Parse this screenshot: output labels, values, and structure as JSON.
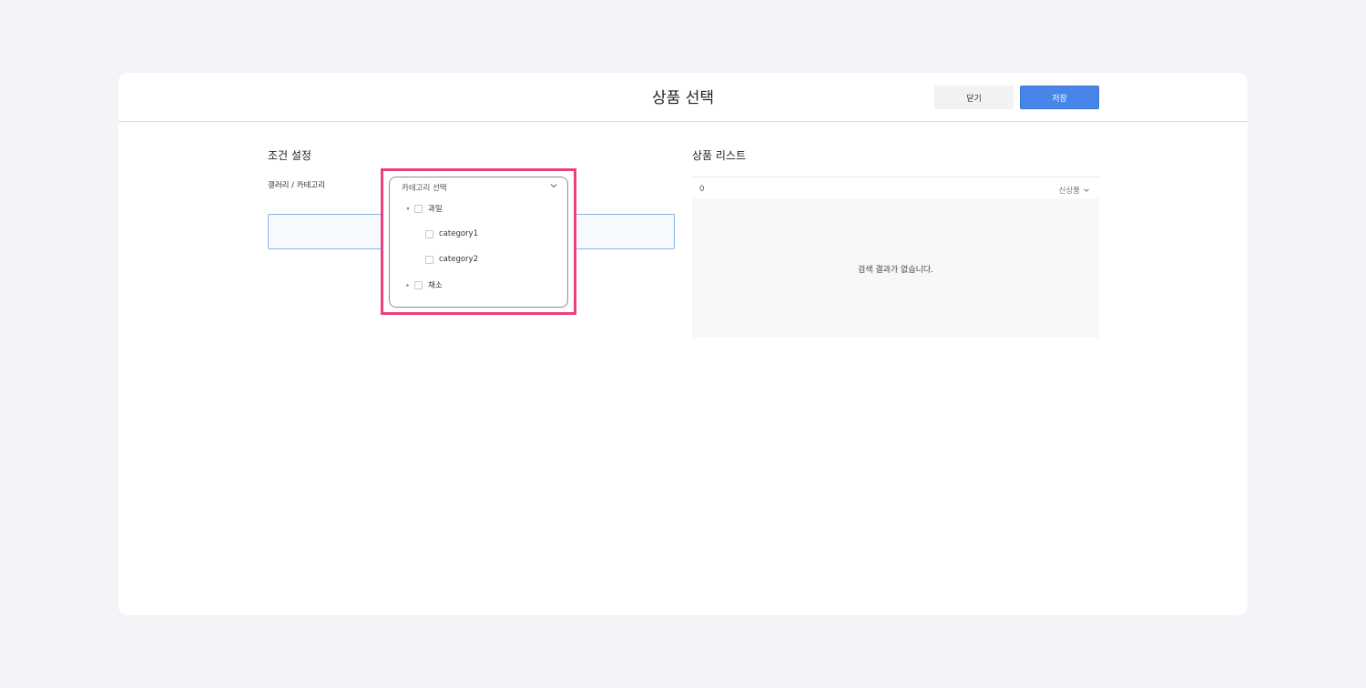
{
  "modal": {
    "title": "상품 선택",
    "close_label": "닫기",
    "save_label": "저장"
  },
  "conditions": {
    "title": "조건 설정",
    "field_label": "갤러리 / 카테고리",
    "dropdown": {
      "placeholder": "카테고리 선택",
      "tree": [
        {
          "label": "과일",
          "expanded": true,
          "checked": false
        },
        {
          "label": "category1",
          "checked": false
        },
        {
          "label": "category2",
          "checked": false
        },
        {
          "label": "채소",
          "expanded": false,
          "checked": false
        }
      ]
    }
  },
  "product_list": {
    "title": "상품 리스트",
    "count": "0",
    "sort_label": "신상품",
    "empty_message": "검색 결과가 없습니다."
  },
  "colors": {
    "accent": "#4786e8",
    "highlight": "#ee3f7a",
    "page_background": "#f3f4f7"
  },
  "icons": {
    "dropdown": "chevron-down-icon",
    "tree_toggle": "caret-icon",
    "sort": "chevron-down-icon"
  }
}
